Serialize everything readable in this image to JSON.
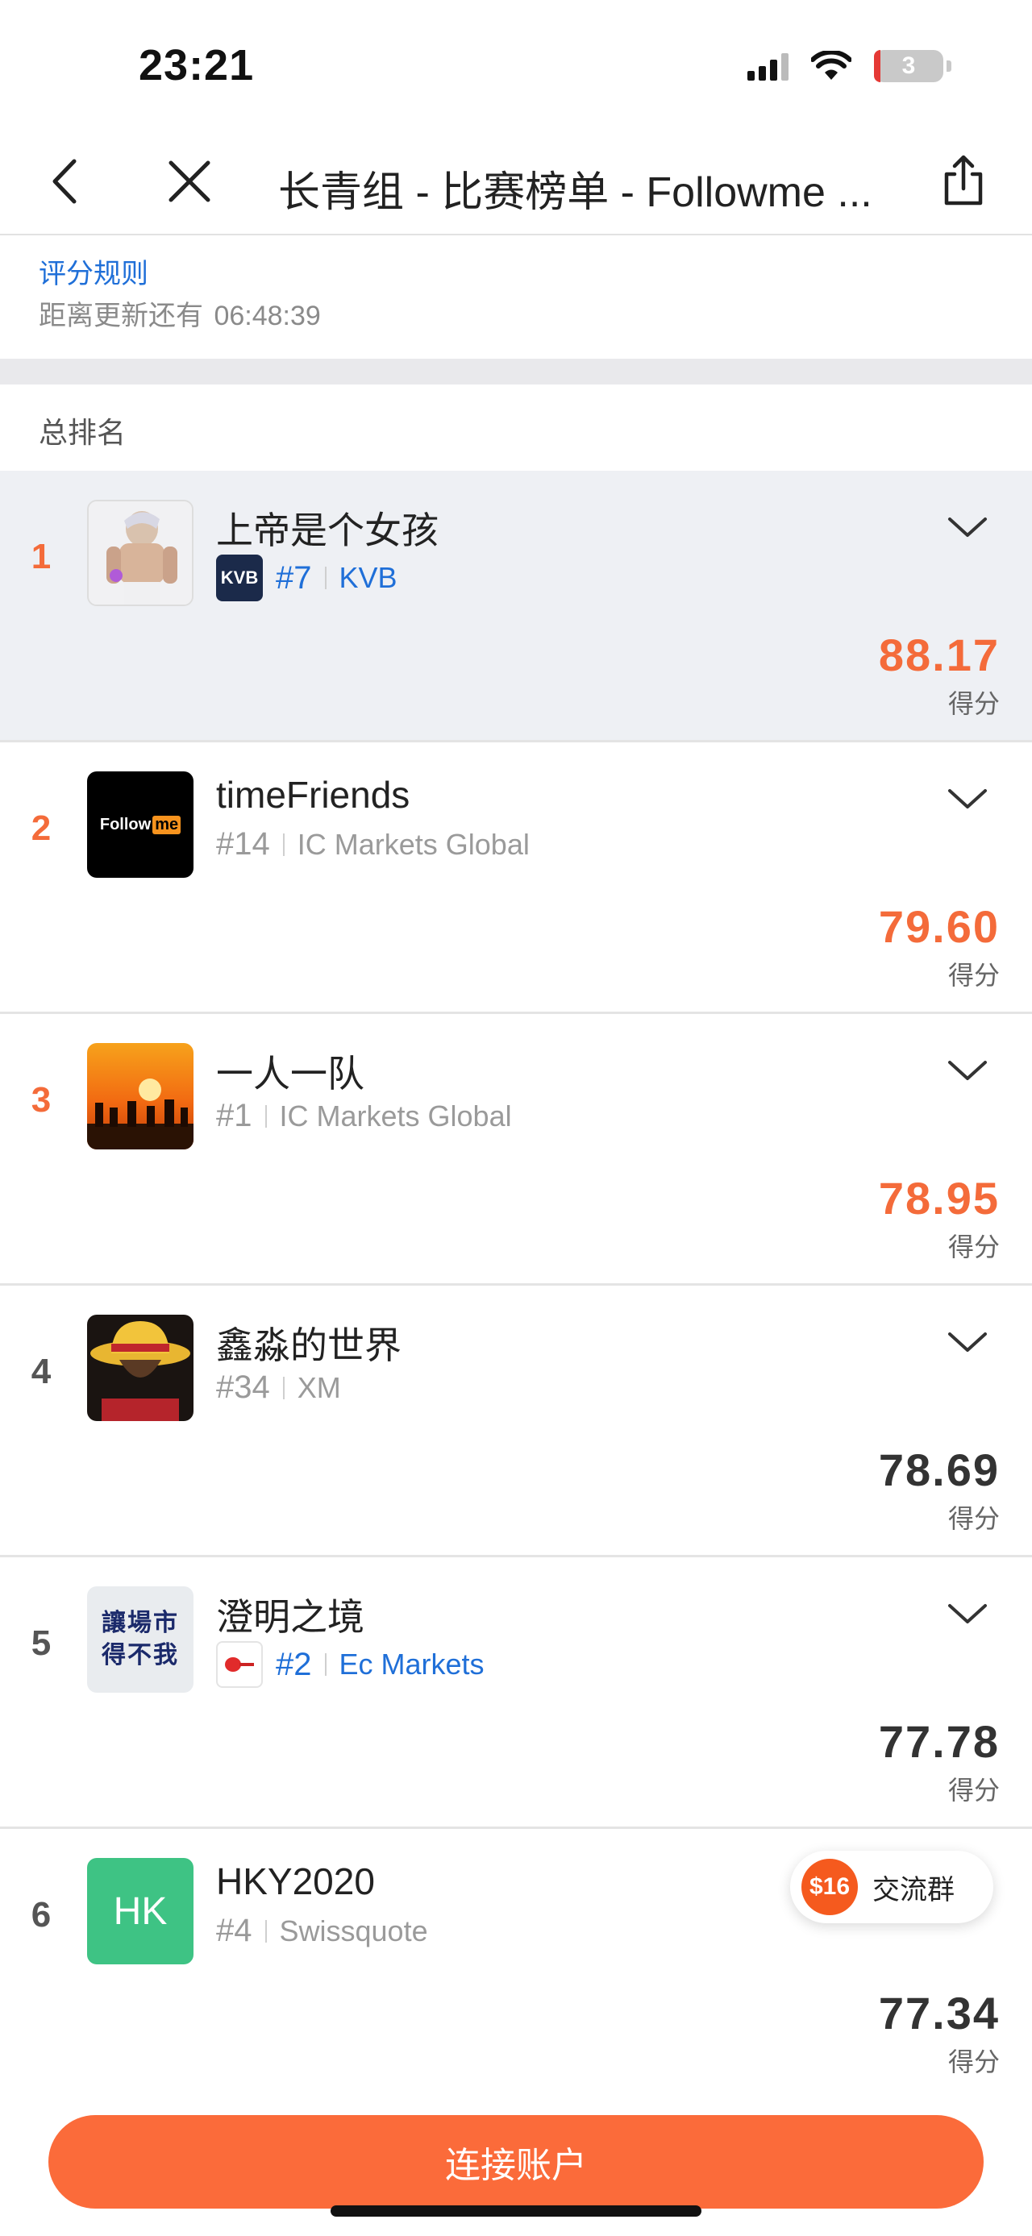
{
  "status_bar": {
    "time": "23:21",
    "battery": "3"
  },
  "nav": {
    "title": "长青组 - 比赛榜单 - Followme ..."
  },
  "info": {
    "rules_link": "评分规则",
    "countdown_label": "距离更新还有",
    "countdown_value": "06:48:39"
  },
  "section_title": "总排名",
  "score_label": "得分",
  "rows": [
    {
      "rank": "1",
      "name": "上帝是个女孩",
      "number": "#7",
      "broker": "KVB",
      "broker_logo_text": "KVB",
      "score": "88.17"
    },
    {
      "rank": "2",
      "name": "timeFriends",
      "number": "#14",
      "broker": "IC Markets Global",
      "avatar_text_a": "Follow",
      "avatar_text_b": "me",
      "score": "79.60"
    },
    {
      "rank": "3",
      "name": "一人一队",
      "number": "#1",
      "broker": "IC Markets Global",
      "score": "78.95"
    },
    {
      "rank": "4",
      "name": "鑫淼的世界",
      "number": "#34",
      "broker": "XM",
      "score": "78.69"
    },
    {
      "rank": "5",
      "name": "澄明之境",
      "number": "#2",
      "broker": "Ec Markets",
      "avatar_text": "讓場市 得不我",
      "score": "77.78"
    },
    {
      "rank": "6",
      "name": "HKY2020",
      "number": "#4",
      "broker": "Swissquote",
      "avatar_text": "HK",
      "score": "77.34"
    }
  ],
  "fab": {
    "badge": "$16",
    "label": "交流群"
  },
  "connect_button": "连接账户",
  "colors": {
    "accent": "#f46b3a",
    "link": "#1f6fd8",
    "button": "#fb6b3a",
    "avatar_green": "#3ec384"
  }
}
